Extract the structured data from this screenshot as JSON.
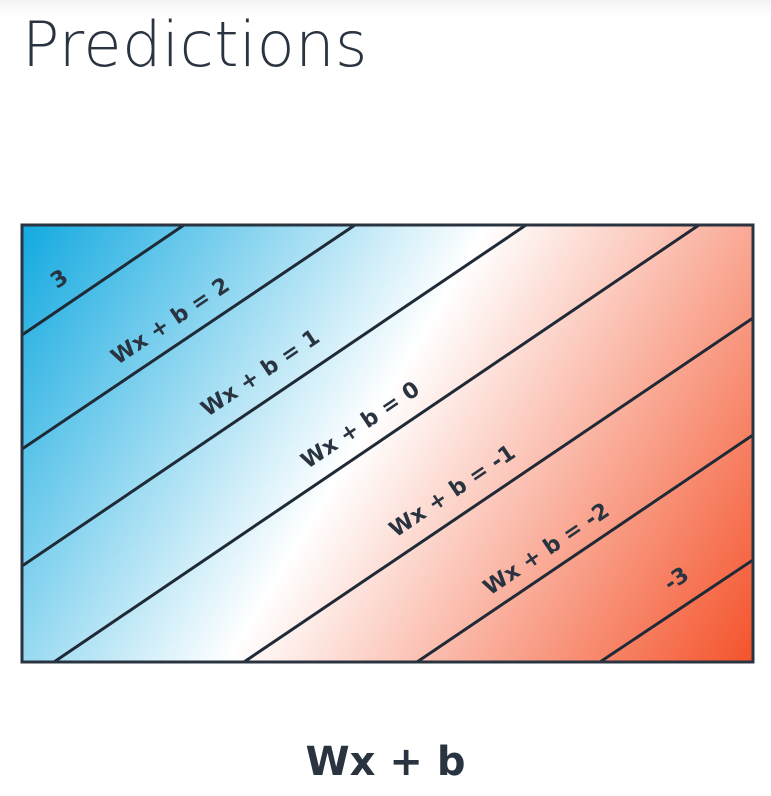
{
  "title": "Predictions",
  "caption": "Wx + b",
  "region_labels": {
    "top_left": "3",
    "bottom_right": "-3"
  },
  "line_labels": [
    "Wx + b = 2",
    "Wx + b = 1",
    "Wx + b = 0",
    "Wx + b = -1",
    "Wx + b = -2"
  ],
  "colors": {
    "positive": "#12a9e0",
    "neutral": "#ffffff",
    "negative": "#f4532b",
    "line": "#1f2a36",
    "text": "#2a3440"
  }
}
